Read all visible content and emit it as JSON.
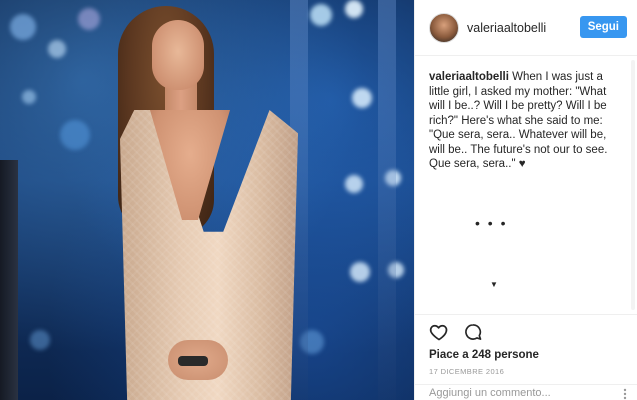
{
  "post": {
    "username": "valeriaaltobelli",
    "follow_label": "Segui",
    "caption_user": "valeriaaltobelli",
    "caption_text": " When I was just a little girl, I asked my mother: \"What will I be..? Will I be pretty? Will I be rich?\" Here's what she said to me: \"Que sera, sera.. Whatever will be, will be.. The future's not our to see. Que sera, sera..\" ♥",
    "ellipsis": "• • •",
    "chevron": "▼",
    "likes_text": "Piace a 248 persone",
    "date_text": "17 DICEMBRE 2016",
    "comment_placeholder": "Aggiungi un commento..."
  },
  "icons": {
    "like": "heart-icon",
    "comment": "comment-icon",
    "options": "options-icon"
  },
  "colors": {
    "accent": "#3897f0",
    "text": "#262626",
    "muted": "#999999"
  }
}
